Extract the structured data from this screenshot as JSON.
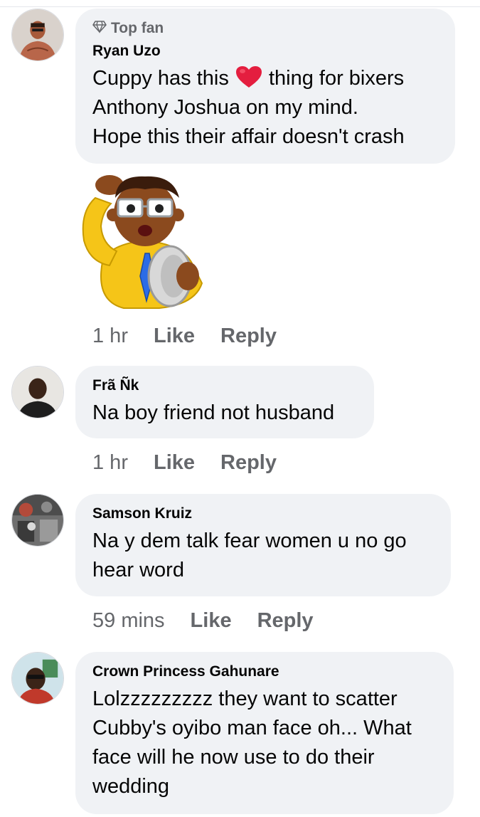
{
  "comments": [
    {
      "badge": "Top fan",
      "name": "Ryan Uzo",
      "lines": [
        "Cuppy has this",
        "thing for bixers",
        "Anthony Joshua on my mind.",
        "Hope this their affair doesn't crash"
      ],
      "time": "1 hr",
      "like": "Like",
      "reply": "Reply"
    },
    {
      "name": "Frã Ñk",
      "lines": [
        "Na boy friend not husband"
      ],
      "time": "1 hr",
      "like": "Like",
      "reply": "Reply"
    },
    {
      "name": "Samson Kruiz",
      "lines": [
        "Na y dem talk fear women u no go",
        "hear word"
      ],
      "time": "59 mins",
      "like": "Like",
      "reply": "Reply"
    },
    {
      "name": "Crown Princess Gahunare",
      "lines": [
        "Lolzzzzzzzzz they want to scatter",
        "Cubby's oyibo man face oh... What",
        "face will he now use to do their",
        "wedding"
      ]
    }
  ],
  "icons": {
    "badge_icon": "diamond-icon",
    "heart_icon": "heart-icon",
    "sticker": "confused-man-sticker"
  },
  "colors": {
    "bubble": "#f0f2f5",
    "secondary_text": "#65676b",
    "heart": "#e41e3f"
  }
}
